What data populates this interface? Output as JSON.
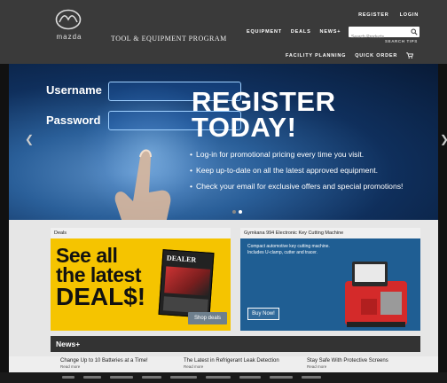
{
  "brand": {
    "wordmark": "mazda",
    "program_title": "TOOL & EQUIPMENT PROGRAM"
  },
  "top_links": [
    "REGISTER",
    "LOGIN"
  ],
  "main_nav": [
    "EQUIPMENT",
    "DEALS",
    "NEWS+"
  ],
  "search": {
    "placeholder": "Search Products",
    "tips": "SEARCH TIPS"
  },
  "sub_nav": [
    "FACILITY PLANNING",
    "QUICK ORDER"
  ],
  "hero": {
    "username_label": "Username",
    "password_label": "Password",
    "title_line1": "REGISTER",
    "title_line2": "TODAY!",
    "bullets": [
      "Log-in for promotional pricing every time you visit.",
      "Keep up-to-date on all the latest approved equipment.",
      "Check your email for exclusive offers and special promotions!"
    ],
    "slide_count": 2,
    "active_slide": 2
  },
  "deals_card": {
    "title": "Deals",
    "line1": "See all",
    "line2": "the latest",
    "line3": "DEAL$!",
    "catalog_title": "DEALER",
    "button": "Shop deals"
  },
  "machine_card": {
    "title": "Gymkana 994 Electronic Key Cutting Machine",
    "description": "Compact automotive key cutting machine. Includes U-clamp, cutter and tracer.",
    "button": "Buy Now!"
  },
  "news": {
    "heading": "News+",
    "items": [
      {
        "title": "Change Up to 10 Batteries at a Time!",
        "read_more": "Read more"
      },
      {
        "title": "The Latest in Refrigerant Leak Detection",
        "read_more": "Read more"
      },
      {
        "title": "Stay Safe With Protective Screens",
        "read_more": "Read more"
      }
    ]
  },
  "colors": {
    "header": "#3a3a3a",
    "deals_yellow": "#f5c400",
    "machine_blue": "#1f5e93",
    "hero_blue": "#0f2f5c"
  }
}
